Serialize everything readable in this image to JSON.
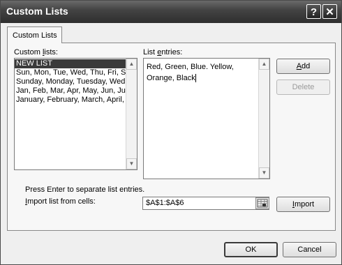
{
  "window": {
    "title": "Custom Lists"
  },
  "titlebar": {
    "help_label": "?",
    "close_label": "✕"
  },
  "tab": {
    "label": "Custom Lists"
  },
  "custom_lists": {
    "label_pre": "Custom ",
    "label_key": "l",
    "label_post": "ists:",
    "items": [
      "NEW LIST",
      "Sun, Mon, Tue, Wed, Thu, Fri, Sat",
      "Sunday, Monday, Tuesday, Wednesday, Thursday, Friday, Saturday",
      "Jan, Feb, Mar, Apr, May, Jun, Jul, Aug, Sep, Oct, Nov, Dec",
      "January, February, March, April, May, June, July, August, September, October, November, December"
    ]
  },
  "list_entries": {
    "label_pre": "List ",
    "label_key": "e",
    "label_post": "ntries:",
    "line1": "Red, Green, Blue. Yellow,",
    "line2": "Orange, Black"
  },
  "buttons": {
    "add_key": "A",
    "add_rest": "dd",
    "delete": "Delete",
    "import_key": "I",
    "import_rest": "mport",
    "ok": "OK",
    "cancel": "Cancel"
  },
  "hint": "Press Enter to separate list entries.",
  "import": {
    "label_key": "I",
    "label_rest": "mport list from cells:",
    "value": "$A$1:$A$6"
  },
  "icons": {
    "scroll_up": "scroll-up-arrow-icon",
    "scroll_down": "scroll-down-arrow-icon",
    "range": "range-selector-icon"
  }
}
